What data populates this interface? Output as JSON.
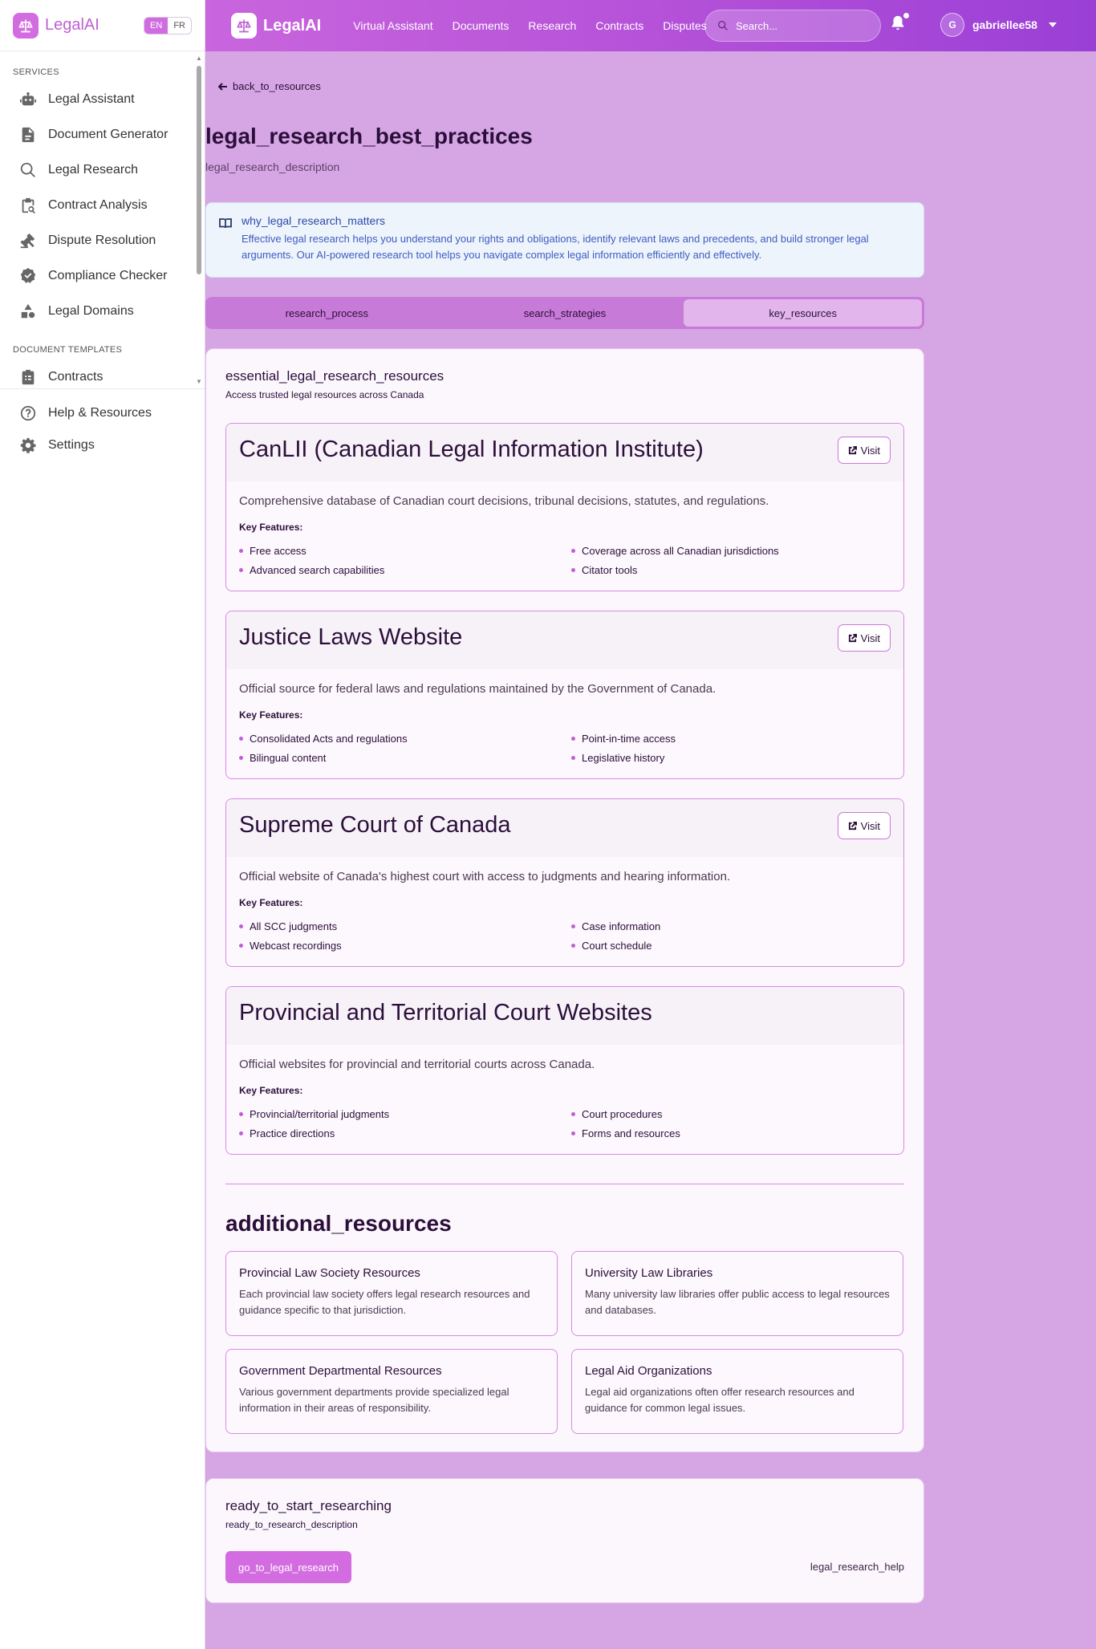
{
  "sidebar": {
    "brand": "LegalAI",
    "lang": {
      "en": "EN",
      "fr": "FR",
      "active": "EN"
    },
    "section_services": "SERVICES",
    "services": [
      {
        "label": "Legal Assistant",
        "icon": "robot-icon"
      },
      {
        "label": "Document Generator",
        "icon": "document-icon"
      },
      {
        "label": "Legal Research",
        "icon": "search-icon"
      },
      {
        "label": "Contract Analysis",
        "icon": "clipboard-search-icon"
      },
      {
        "label": "Dispute Resolution",
        "icon": "gavel-icon"
      },
      {
        "label": "Compliance Checker",
        "icon": "badge-check-icon"
      },
      {
        "label": "Legal Domains",
        "icon": "shapes-icon"
      }
    ],
    "section_templates": "DOCUMENT TEMPLATES",
    "templates": [
      {
        "label": "Contracts",
        "icon": "clipboard-list-icon"
      }
    ],
    "bottom": [
      {
        "label": "Help & Resources",
        "icon": "help-circle-icon"
      },
      {
        "label": "Settings",
        "icon": "gear-icon"
      }
    ]
  },
  "topbar": {
    "brand": "LegalAI",
    "nav": [
      "Virtual Assistant",
      "Documents",
      "Research",
      "Contracts",
      "Disputes"
    ],
    "search_placeholder": "Search...",
    "user": {
      "initial": "G",
      "name": "gabriellee58"
    }
  },
  "page": {
    "back_label": "back_to_resources",
    "title": "legal_research_best_practices",
    "description": "legal_research_description",
    "callout": {
      "title": "why_legal_research_matters",
      "text": "Effective legal research helps you understand your rights and obligations, identify relevant laws and precedents, and build stronger legal arguments. Our AI-powered research tool helps you navigate complex legal information efficiently and effectively."
    },
    "tabs": [
      {
        "label": "research_process",
        "active": false
      },
      {
        "label": "search_strategies",
        "active": false
      },
      {
        "label": "key_resources",
        "active": true
      }
    ],
    "resources_heading": "essential_legal_research_resources",
    "resources_subheading": "Access trusted legal resources across Canada",
    "key_features_label": "Key Features:",
    "visit_label": "Visit",
    "resources": [
      {
        "title": "CanLII (Canadian Legal Information Institute)",
        "description": "Comprehensive database of Canadian court decisions, tribunal decisions, statutes, and regulations.",
        "has_visit": true,
        "features": [
          "Free access",
          "Coverage across all Canadian jurisdictions",
          "Advanced search capabilities",
          "Citator tools"
        ]
      },
      {
        "title": "Justice Laws Website",
        "description": "Official source for federal laws and regulations maintained by the Government of Canada.",
        "has_visit": true,
        "features": [
          "Consolidated Acts and regulations",
          "Point-in-time access",
          "Bilingual content",
          "Legislative history"
        ]
      },
      {
        "title": "Supreme Court of Canada",
        "description": "Official website of Canada's highest court with access to judgments and hearing information.",
        "has_visit": true,
        "features": [
          "All SCC judgments",
          "Case information",
          "Webcast recordings",
          "Court schedule"
        ]
      },
      {
        "title": "Provincial and Territorial Court Websites",
        "description": "Official websites for provincial and territorial courts across Canada.",
        "has_visit": false,
        "features": [
          "Provincial/territorial judgments",
          "Court procedures",
          "Practice directions",
          "Forms and resources"
        ]
      }
    ],
    "additional_title": "additional_resources",
    "additional": [
      {
        "title": "Provincial Law Society Resources",
        "description": "Each provincial law society offers legal research resources and guidance specific to that jurisdiction."
      },
      {
        "title": "University Law Libraries",
        "description": "Many university law libraries offer public access to legal resources and databases."
      },
      {
        "title": "Government Departmental Resources",
        "description": "Various government departments provide specialized legal information in their areas of responsibility."
      },
      {
        "title": "Legal Aid Organizations",
        "description": "Legal aid organizations often offer research resources and guidance for common legal issues."
      }
    ],
    "cta": {
      "title": "ready_to_start_researching",
      "description": "ready_to_research_description",
      "button": "go_to_legal_research",
      "help": "legal_research_help"
    }
  },
  "colors": {
    "accent": "#d36ce0",
    "page_bg": "#d6a6e4",
    "topbar": "#b14ed8"
  }
}
